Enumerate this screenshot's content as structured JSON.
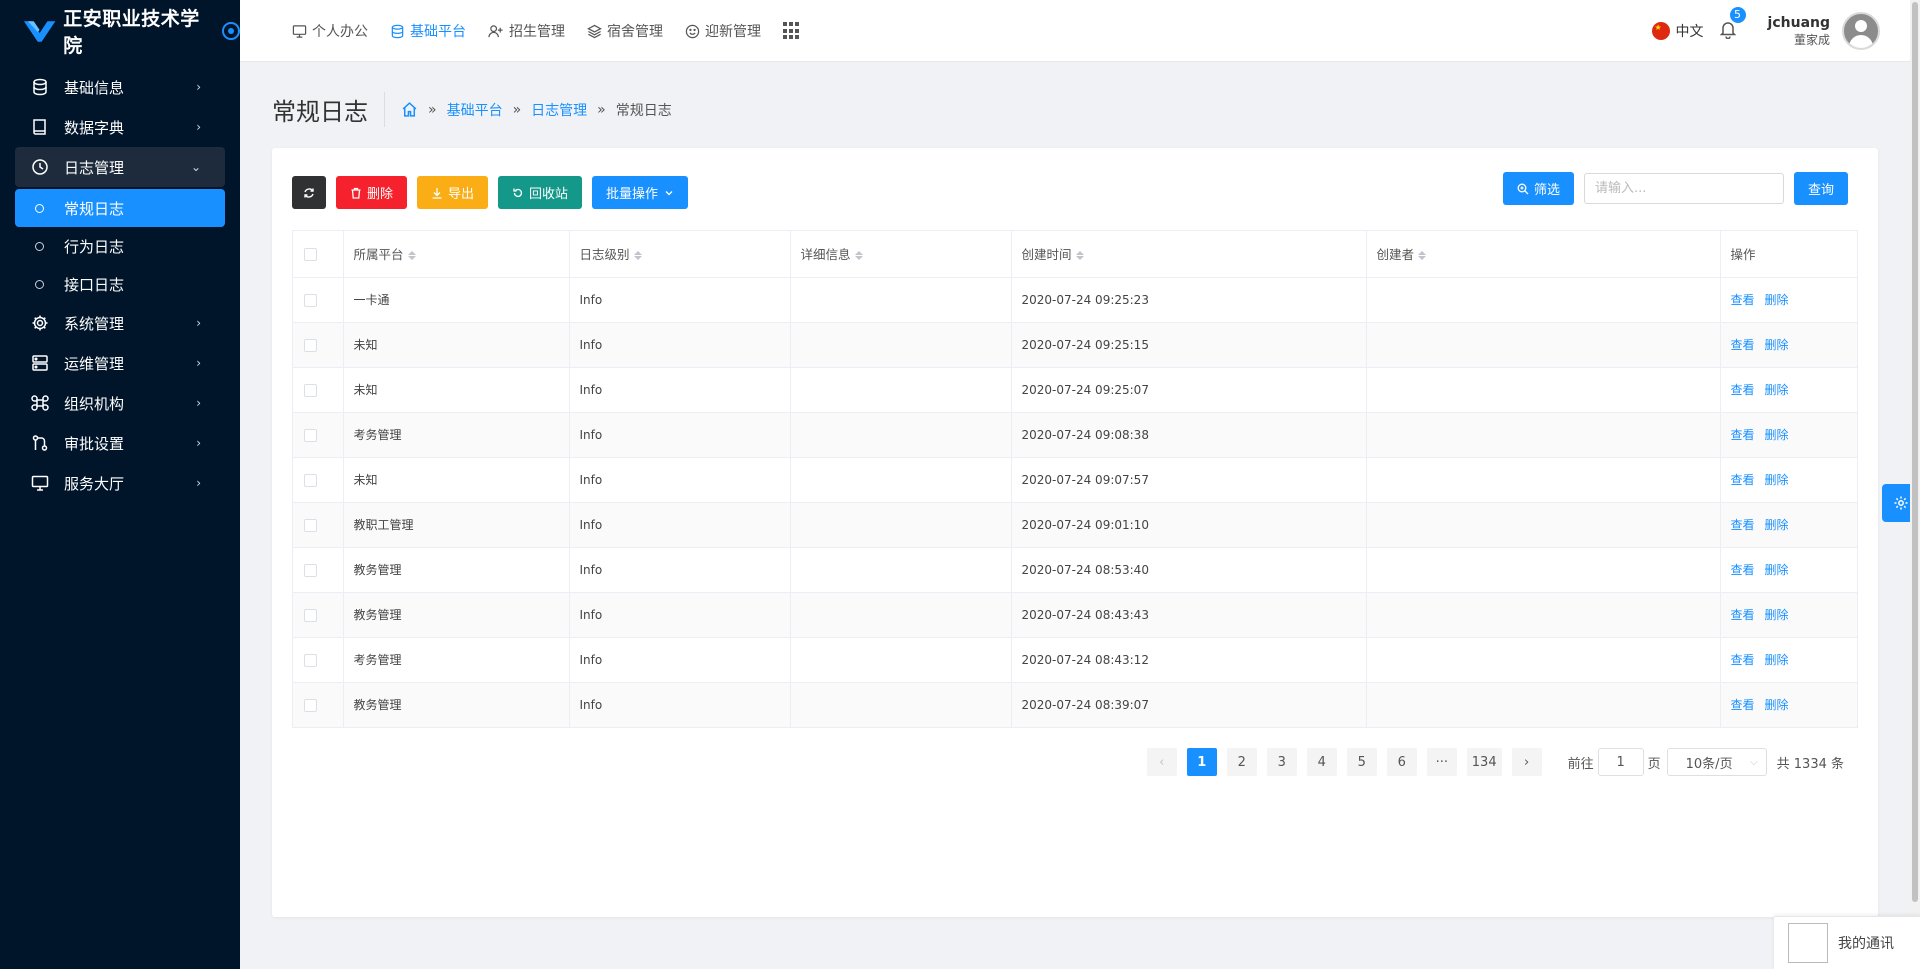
{
  "app": {
    "name": "正安职业技术学院"
  },
  "sidebar": {
    "items": [
      {
        "label": "基础信息",
        "icon": "database-icon"
      },
      {
        "label": "数据字典",
        "icon": "book-icon"
      },
      {
        "label": "日志管理",
        "icon": "clock-icon",
        "open": true,
        "children": [
          {
            "label": "常规日志",
            "active": true
          },
          {
            "label": "行为日志"
          },
          {
            "label": "接口日志"
          }
        ]
      },
      {
        "label": "系统管理",
        "icon": "gear-icon"
      },
      {
        "label": "运维管理",
        "icon": "server-icon"
      },
      {
        "label": "组织机构",
        "icon": "command-icon"
      },
      {
        "label": "审批设置",
        "icon": "flow-icon"
      },
      {
        "label": "服务大厅",
        "icon": "monitor-icon"
      }
    ]
  },
  "topnav": {
    "items": [
      {
        "label": "个人办公",
        "icon": "desktop-icon"
      },
      {
        "label": "基础平台",
        "icon": "database-icon",
        "active": true
      },
      {
        "label": "招生管理",
        "icon": "user-plus-icon"
      },
      {
        "label": "宿舍管理",
        "icon": "layers-icon"
      },
      {
        "label": "迎新管理",
        "icon": "smile-icon"
      }
    ],
    "language": "中文",
    "notification_count": "5",
    "user_name": "jchuang",
    "user_display": "董家成"
  },
  "page": {
    "title": "常规日志",
    "breadcrumb": [
      "基础平台",
      "日志管理",
      "常规日志"
    ]
  },
  "toolbar": {
    "delete_label": "删除",
    "export_label": "导出",
    "recycle_label": "回收站",
    "batch_label": "批量操作",
    "filter_label": "筛选",
    "search_placeholder": "请输入...",
    "query_label": "查询"
  },
  "table": {
    "columns": [
      "所属平台",
      "日志级别",
      "详细信息",
      "创建时间",
      "创建者",
      "操作"
    ],
    "row_actions": {
      "view": "查看",
      "delete": "删除"
    },
    "rows": [
      {
        "platform": "一卡通",
        "level": "Info",
        "detail": "",
        "created": "2020-07-24 09:25:23",
        "creator": ""
      },
      {
        "platform": "未知",
        "level": "Info",
        "detail": "",
        "created": "2020-07-24 09:25:15",
        "creator": ""
      },
      {
        "platform": "未知",
        "level": "Info",
        "detail": "",
        "created": "2020-07-24 09:25:07",
        "creator": ""
      },
      {
        "platform": "考务管理",
        "level": "Info",
        "detail": "",
        "created": "2020-07-24 09:08:38",
        "creator": ""
      },
      {
        "platform": "未知",
        "level": "Info",
        "detail": "",
        "created": "2020-07-24 09:07:57",
        "creator": ""
      },
      {
        "platform": "教职工管理",
        "level": "Info",
        "detail": "",
        "created": "2020-07-24 09:01:10",
        "creator": ""
      },
      {
        "platform": "教务管理",
        "level": "Info",
        "detail": "",
        "created": "2020-07-24 08:53:40",
        "creator": ""
      },
      {
        "platform": "教务管理",
        "level": "Info",
        "detail": "",
        "created": "2020-07-24 08:43:43",
        "creator": ""
      },
      {
        "platform": "考务管理",
        "level": "Info",
        "detail": "",
        "created": "2020-07-24 08:43:12",
        "creator": ""
      },
      {
        "platform": "教务管理",
        "level": "Info",
        "detail": "",
        "created": "2020-07-24 08:39:07",
        "creator": ""
      }
    ]
  },
  "pagination": {
    "pages": [
      "1",
      "2",
      "3",
      "4",
      "5",
      "6",
      "···",
      "134"
    ],
    "current": "1",
    "goto_prefix": "前往",
    "goto_value": "1",
    "goto_suffix": "页",
    "page_size": "10条/页",
    "total": "共 1334 条"
  },
  "chat": {
    "label": "我的通讯"
  },
  "colors": {
    "sidebar_bg": "#00142a",
    "primary": "#1890ff",
    "danger": "#f5222d",
    "warning": "#faad14",
    "teal": "#13988a",
    "dark": "#303133"
  }
}
